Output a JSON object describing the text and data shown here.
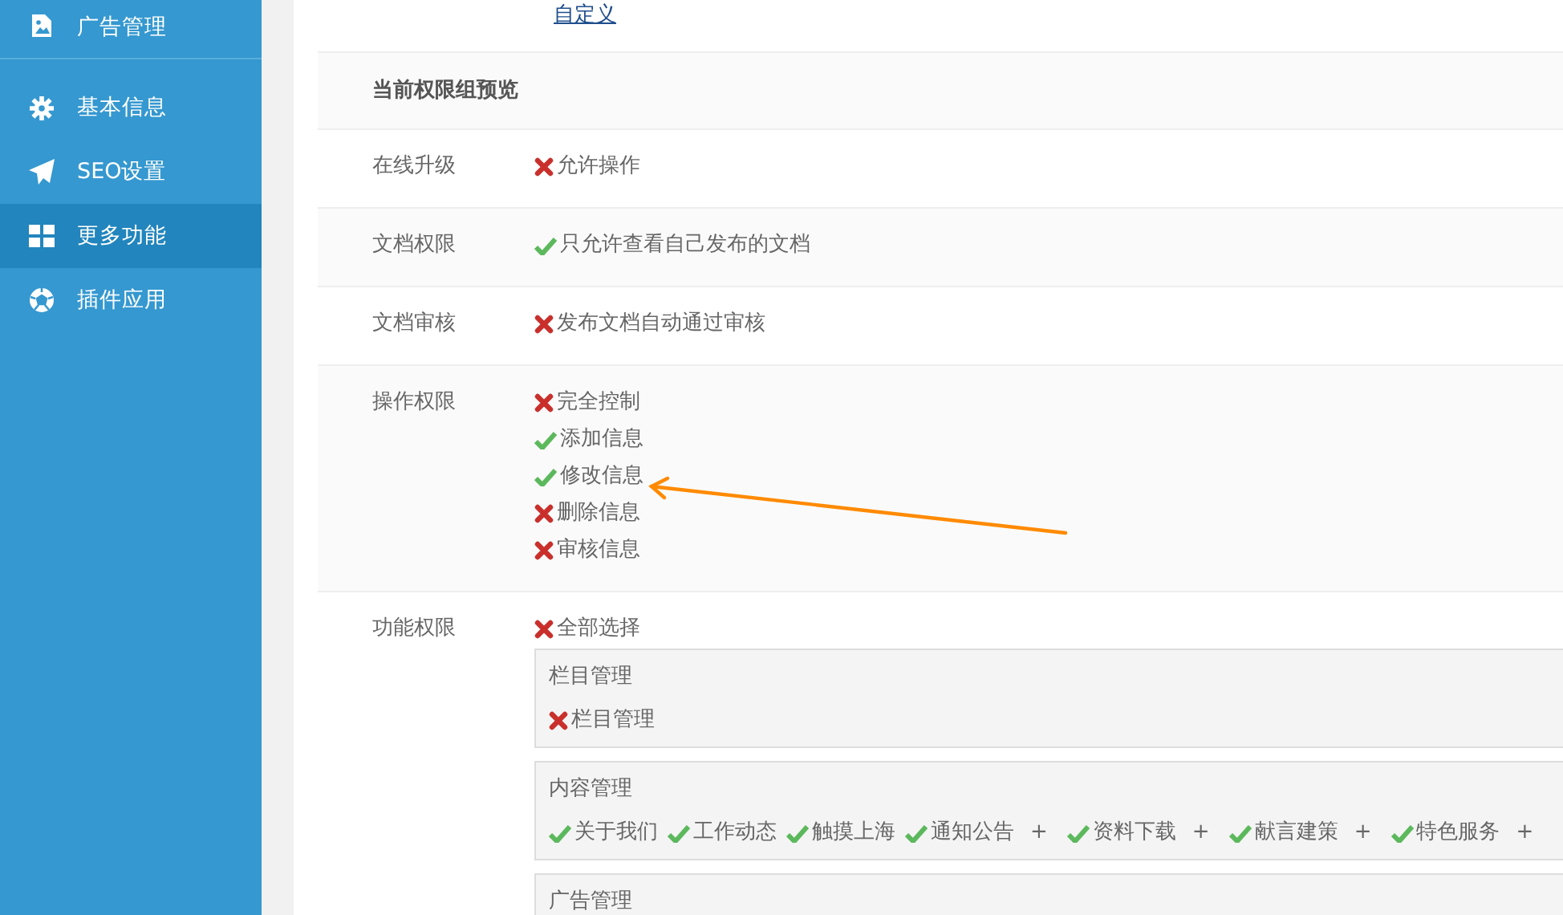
{
  "sidebar": {
    "items": [
      {
        "label": "广告管理",
        "selected": false
      },
      {
        "label": "基本信息",
        "selected": false
      },
      {
        "label": "SEO设置",
        "selected": false
      },
      {
        "label": "更多功能",
        "selected": true
      },
      {
        "label": "插件应用",
        "selected": false
      }
    ]
  },
  "custom_link": "自定义",
  "preview": {
    "title": "当前权限组预览",
    "rows": [
      {
        "label": "在线升级",
        "items": [
          {
            "label": "允许操作",
            "checked": false
          }
        ]
      },
      {
        "label": "文档权限",
        "items": [
          {
            "label": "只允许查看自己发布的文档",
            "checked": true
          }
        ]
      },
      {
        "label": "文档审核",
        "items": [
          {
            "label": "发布文档自动通过审核",
            "checked": false
          }
        ]
      },
      {
        "label": "操作权限",
        "items": [
          {
            "label": "完全控制",
            "checked": false
          },
          {
            "label": "添加信息",
            "checked": true
          },
          {
            "label": "修改信息",
            "checked": true
          },
          {
            "label": "删除信息",
            "checked": false
          },
          {
            "label": "审核信息",
            "checked": false
          }
        ]
      }
    ],
    "function_row": {
      "label": "功能权限",
      "select_all": {
        "label": "全部选择",
        "checked": false
      },
      "groups": [
        {
          "title": "栏目管理",
          "items": [
            {
              "label": "栏目管理",
              "checked": false
            }
          ]
        },
        {
          "title": "内容管理",
          "items": [
            {
              "label": "关于我们",
              "checked": true
            },
            {
              "label": "工作动态",
              "checked": true
            },
            {
              "label": "触摸上海",
              "checked": true
            },
            {
              "label": "通知公告",
              "checked": true,
              "expand": "+"
            },
            {
              "label": "资料下载",
              "checked": true,
              "expand": "+"
            },
            {
              "label": "献言建策",
              "checked": true,
              "expand": "+"
            },
            {
              "label": "特色服务",
              "checked": true,
              "expand": "+"
            }
          ]
        },
        {
          "title": "广告管理"
        }
      ]
    }
  }
}
